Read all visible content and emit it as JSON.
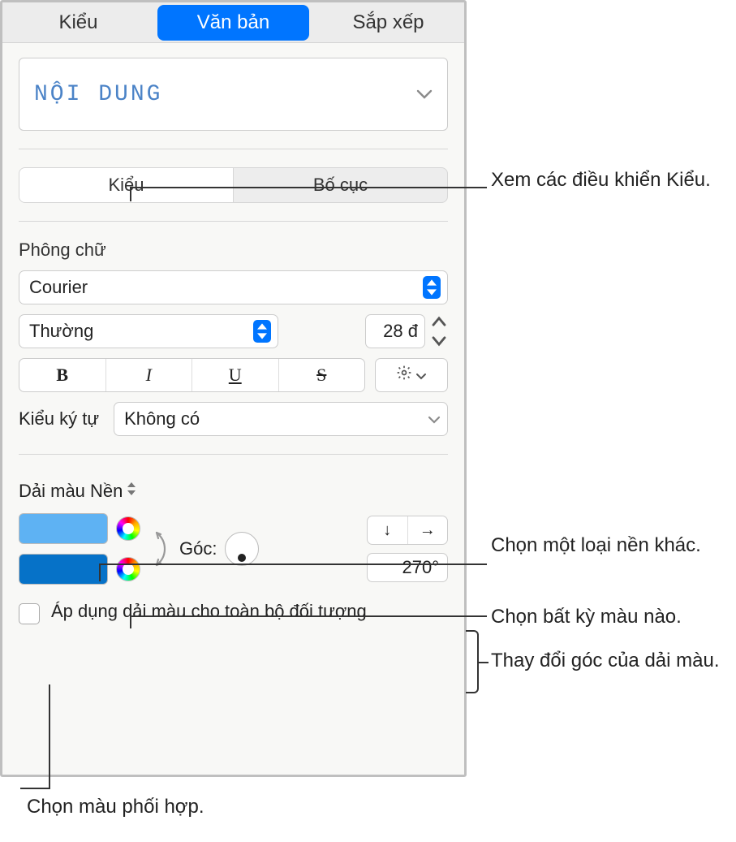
{
  "tabs": {
    "style": "Kiểu",
    "text": "Văn bản",
    "arrange": "Sắp xếp"
  },
  "paragraph_style": "NỘI DUNG",
  "subtabs": {
    "style": "Kiểu",
    "layout": "Bố cục"
  },
  "font": {
    "section": "Phông chữ",
    "family": "Courier",
    "weight": "Thường",
    "size": "28 đ",
    "char_style_label": "Kiểu ký tự",
    "char_style": "Không có"
  },
  "fill": {
    "label": "Dải màu Nền",
    "angle_label": "Góc:",
    "angle": "270°",
    "apply": "Áp dụng dải màu cho toàn bộ đối tượng"
  },
  "callouts": {
    "c1": "Xem các điều khiển Kiểu.",
    "c2": "Chọn một loại nền khác.",
    "c3": "Chọn bất kỳ màu nào.",
    "c4": "Thay đổi góc của dải màu.",
    "c5": "Chọn màu phối hợp."
  }
}
